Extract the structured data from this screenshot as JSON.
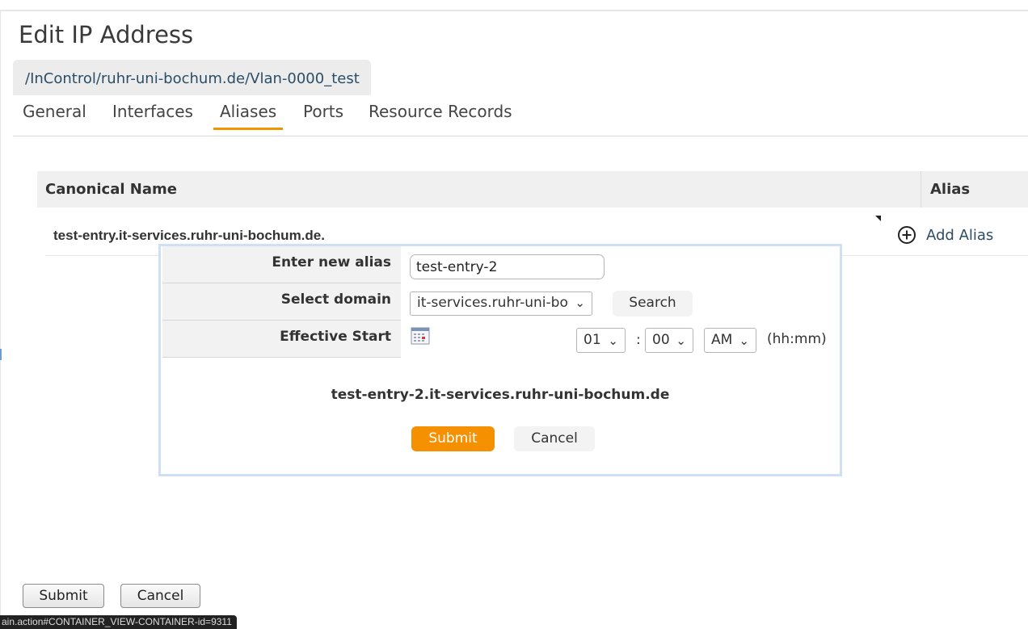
{
  "page": {
    "title": "Edit IP Address",
    "breadcrumb": "/InControl/ruhr-uni-bochum.de/Vlan-0000_test"
  },
  "tabs": [
    {
      "label": "General",
      "active": false
    },
    {
      "label": "Interfaces",
      "active": false
    },
    {
      "label": "Aliases",
      "active": true
    },
    {
      "label": "Ports",
      "active": false
    },
    {
      "label": "Resource Records",
      "active": false
    }
  ],
  "grid": {
    "headers": {
      "canonical": "Canonical Name",
      "alias": "Alias"
    },
    "rows": [
      {
        "canonical_name": "test-entry.it-services.ruhr-uni-bochum.de.",
        "action_label": "Add Alias",
        "action_icon": "plus-circle-icon"
      }
    ]
  },
  "alias_form": {
    "alias_label": "Enter new alias",
    "alias_value": "test-entry-2",
    "domain_label": "Select domain",
    "domain_value": "it-services.ruhr-uni-bochum.de",
    "search_label": "Search",
    "start_label": "Effective Start",
    "calendar_icon": "calendar-icon",
    "hour": "01",
    "colon": ":",
    "minute": "00",
    "ampm": "AM",
    "time_format": "(hh:mm)",
    "preview": "test-entry-2.it-services.ruhr-uni-bochum.de",
    "submit_label": "Submit",
    "cancel_label": "Cancel"
  },
  "footer": {
    "submit_label": "Submit",
    "cancel_label": "Cancel"
  },
  "status_bar": {
    "url": "ain.action#CONTAINER_VIEW-CONTAINER-id=9311"
  },
  "colors": {
    "accent": "#f59000",
    "link": "#2b4d66",
    "popup_border": "#cfe0f5"
  }
}
